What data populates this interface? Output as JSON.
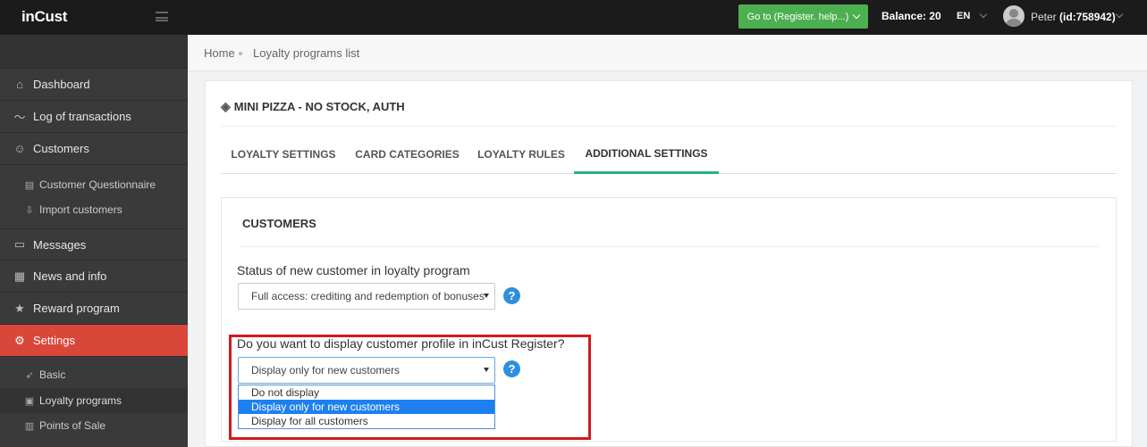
{
  "header": {
    "logo": "inCust",
    "goto_button": "Go to (Register. help...)",
    "balance_label": "Balance:",
    "balance_value": "20",
    "language": "EN",
    "user_name": "Peter",
    "user_id": "(id:758942)"
  },
  "sidebar": {
    "items": [
      {
        "label": "Dashboard",
        "icon": "home-icon"
      },
      {
        "label": "Log of transactions",
        "icon": "chart-line-icon"
      },
      {
        "label": "Customers",
        "icon": "users-icon"
      },
      {
        "label": "Customer Questionnaire",
        "icon": "document-icon"
      },
      {
        "label": "Import customers",
        "icon": "download-icon"
      },
      {
        "label": "Messages",
        "icon": "message-icon"
      },
      {
        "label": "News and info",
        "icon": "newspaper-icon"
      },
      {
        "label": "Reward program",
        "icon": "star-icon"
      },
      {
        "label": "Settings",
        "icon": "gear-icon"
      },
      {
        "label": "Basic",
        "icon": "rocket-icon"
      },
      {
        "label": "Loyalty programs",
        "icon": "briefcase-icon"
      },
      {
        "label": "Points of Sale",
        "icon": "building-icon"
      }
    ]
  },
  "breadcrumb": {
    "home": "Home",
    "current": "Loyalty programs list"
  },
  "program": {
    "title": "MINI PIZZA - NO STOCK, AUTH"
  },
  "tabs": [
    {
      "label": "LOYALTY SETTINGS"
    },
    {
      "label": "CARD CATEGORIES"
    },
    {
      "label": "LOYALTY RULES"
    },
    {
      "label": "ADDITIONAL SETTINGS"
    }
  ],
  "customers_section": {
    "title": "CUSTOMERS",
    "status_label": "Status of new customer in loyalty program",
    "status_value": "Full access: crediting and redemption of bonuses",
    "display_label": "Do you want to display customer profile in inCust Register?",
    "display_value": "Display only for new customers",
    "display_options": [
      "Do not display",
      "Display only for new customers",
      "Display for all customers"
    ],
    "help_glyph": "?"
  },
  "colors": {
    "accent_green": "#26b37a",
    "active_nav": "#d9473a",
    "highlight_red": "#d21a1f",
    "selected_option": "#1e80f0"
  }
}
